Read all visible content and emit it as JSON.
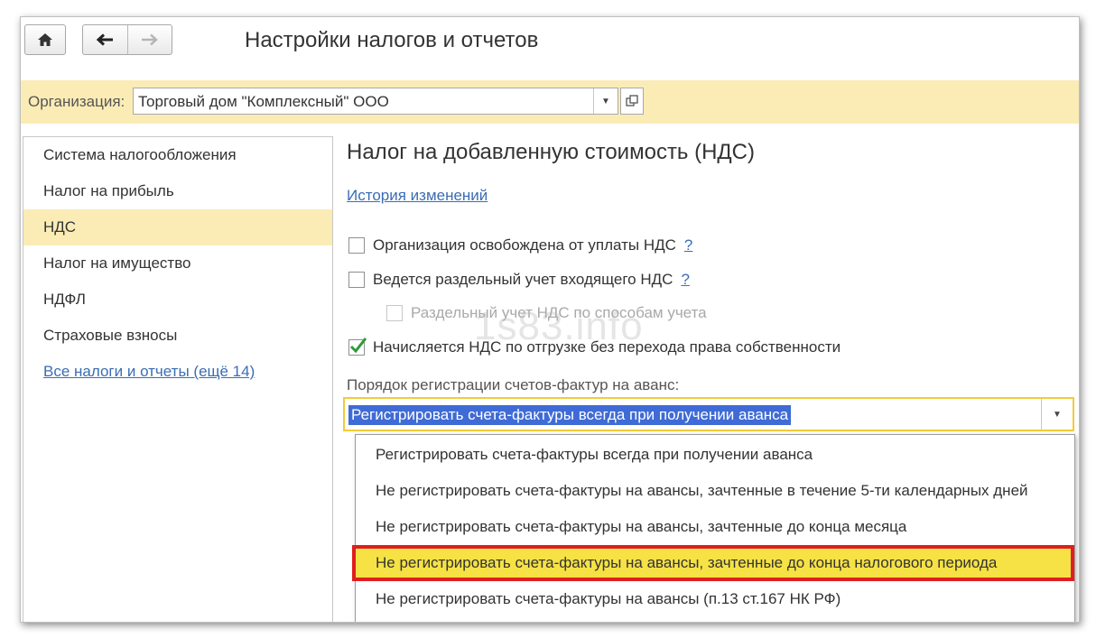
{
  "window": {
    "title": "Настройки налогов и отчетов"
  },
  "organization": {
    "label": "Организация:",
    "value": "Торговый дом \"Комплексный\" ООО"
  },
  "sidebar": {
    "items": [
      {
        "label": "Система налогообложения"
      },
      {
        "label": "Налог на прибыль"
      },
      {
        "label": "НДС"
      },
      {
        "label": "Налог на имущество"
      },
      {
        "label": "НДФЛ"
      },
      {
        "label": "Страховые взносы"
      },
      {
        "label": "Все налоги и отчеты (ещё 14)"
      }
    ],
    "active_index": 2
  },
  "main": {
    "heading": "Налог на добавленную стоимость (НДС)",
    "history_link": "История изменений",
    "checkboxes": [
      {
        "label": "Организация освобождена от уплаты НДС",
        "checked": false,
        "help": "?"
      },
      {
        "label": "Ведется раздельный учет входящего НДС",
        "checked": false,
        "help": "?"
      },
      {
        "label": "Раздельный учет НДС по способам учета",
        "checked": false,
        "disabled": true
      },
      {
        "label": "Начисляется НДС по отгрузке без перехода права собственности",
        "checked": true
      }
    ],
    "invoice_order": {
      "label": "Порядок регистрации счетов-фактур на аванс:",
      "selected": "Регистрировать счета-фактуры всегда при получении аванса",
      "options": [
        "Регистрировать счета-фактуры всегда при получении аванса",
        "Не регистрировать счета-фактуры на авансы, зачтенные в течение 5-ти календарных дней",
        "Не регистрировать счета-фактуры на авансы, зачтенные до конца месяца",
        "Не регистрировать счета-фактуры на авансы, зачтенные до конца налогового периода",
        "Не регистрировать счета-фактуры на авансы (п.13 ст.167 НК РФ)"
      ],
      "highlighted_index": 3
    }
  },
  "watermark": "1s83.info",
  "colors": {
    "highlight_bar": "#fbecb6",
    "link": "#3a6db5",
    "selection": "#3f6bd6",
    "option_highlight": "#f6e244",
    "option_border": "#e01e1e",
    "checkmark": "#2f9a3a"
  }
}
